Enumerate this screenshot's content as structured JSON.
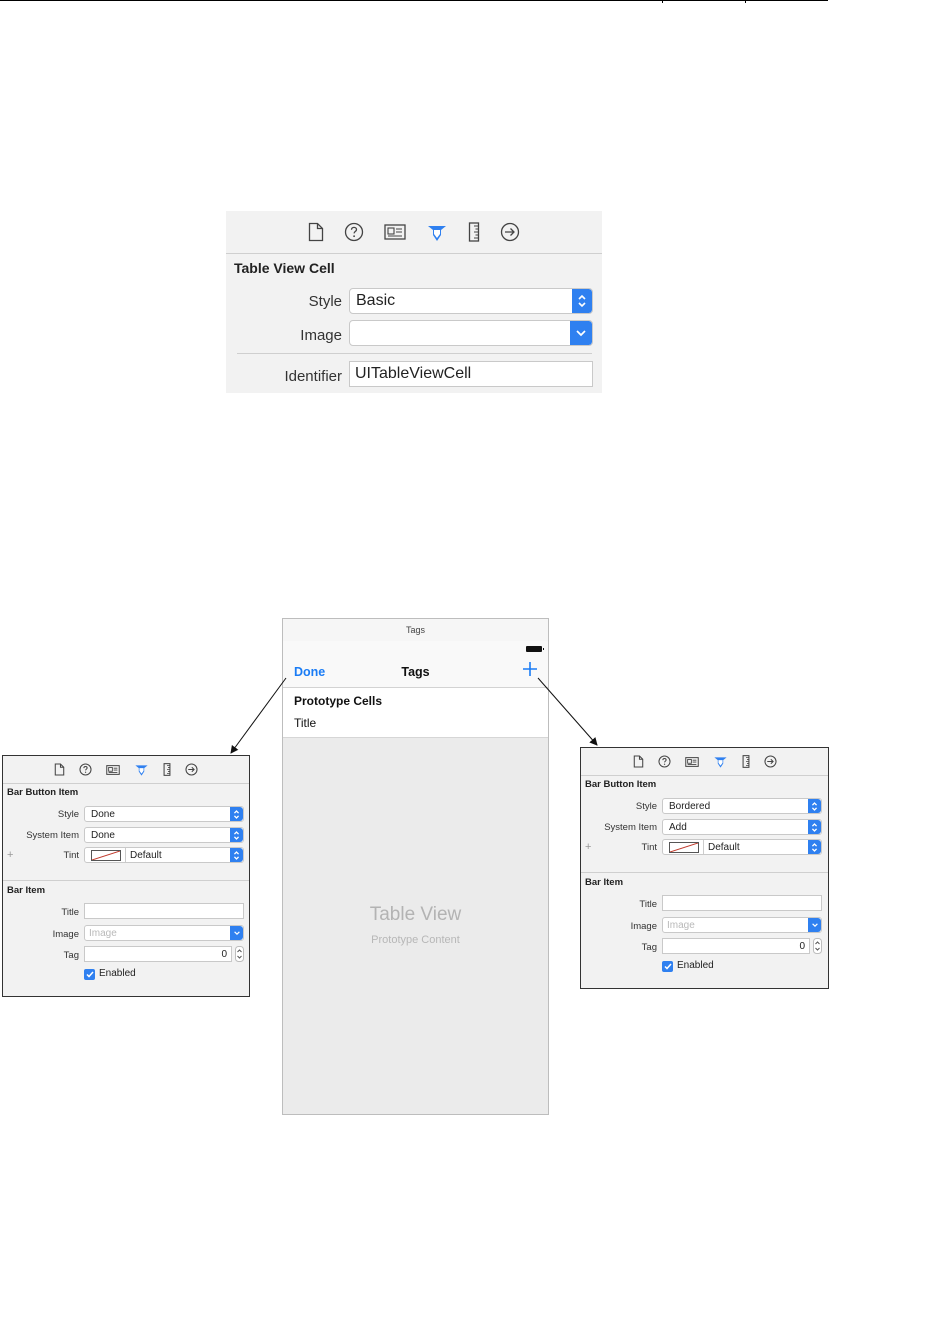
{
  "colors": {
    "accent": "#2f80f0",
    "link": "#1a7cf5",
    "panel_bg": "#f2f2f2"
  },
  "inspector_tabs": [
    "file-icon",
    "help-icon",
    "identity-icon",
    "attributes-icon",
    "size-ruler-icon",
    "connections-icon"
  ],
  "table_view_cell_inspector": {
    "section": "Table View Cell",
    "style_label": "Style",
    "style_value": "Basic",
    "image_label": "Image",
    "image_value": "",
    "identifier_label": "Identifier",
    "identifier_value": "UITableViewCell"
  },
  "left_inspector": {
    "section1": "Bar Button Item",
    "style_label": "Style",
    "style_value": "Done",
    "system_item_label": "System Item",
    "system_item_value": "Done",
    "tint_label": "Tint",
    "tint_value": "Default",
    "section2": "Bar Item",
    "title_label": "Title",
    "title_value": "",
    "image_label": "Image",
    "image_placeholder": "Image",
    "tag_label": "Tag",
    "tag_value": "0",
    "enabled_label": "Enabled"
  },
  "right_inspector": {
    "section1": "Bar Button Item",
    "style_label": "Style",
    "style_value": "Bordered",
    "system_item_label": "System Item",
    "system_item_value": "Add",
    "tint_label": "Tint",
    "tint_value": "Default",
    "section2": "Bar Item",
    "title_label": "Title",
    "title_value": "",
    "image_label": "Image",
    "image_placeholder": "Image",
    "tag_label": "Tag",
    "tag_value": "0",
    "enabled_label": "Enabled"
  },
  "phone": {
    "scene_title": "Tags",
    "nav_left": "Done",
    "nav_title": "Tags",
    "section_header": "Prototype Cells",
    "cell_title": "Title",
    "placeholder_title": "Table View",
    "placeholder_subtitle": "Prototype Content"
  }
}
